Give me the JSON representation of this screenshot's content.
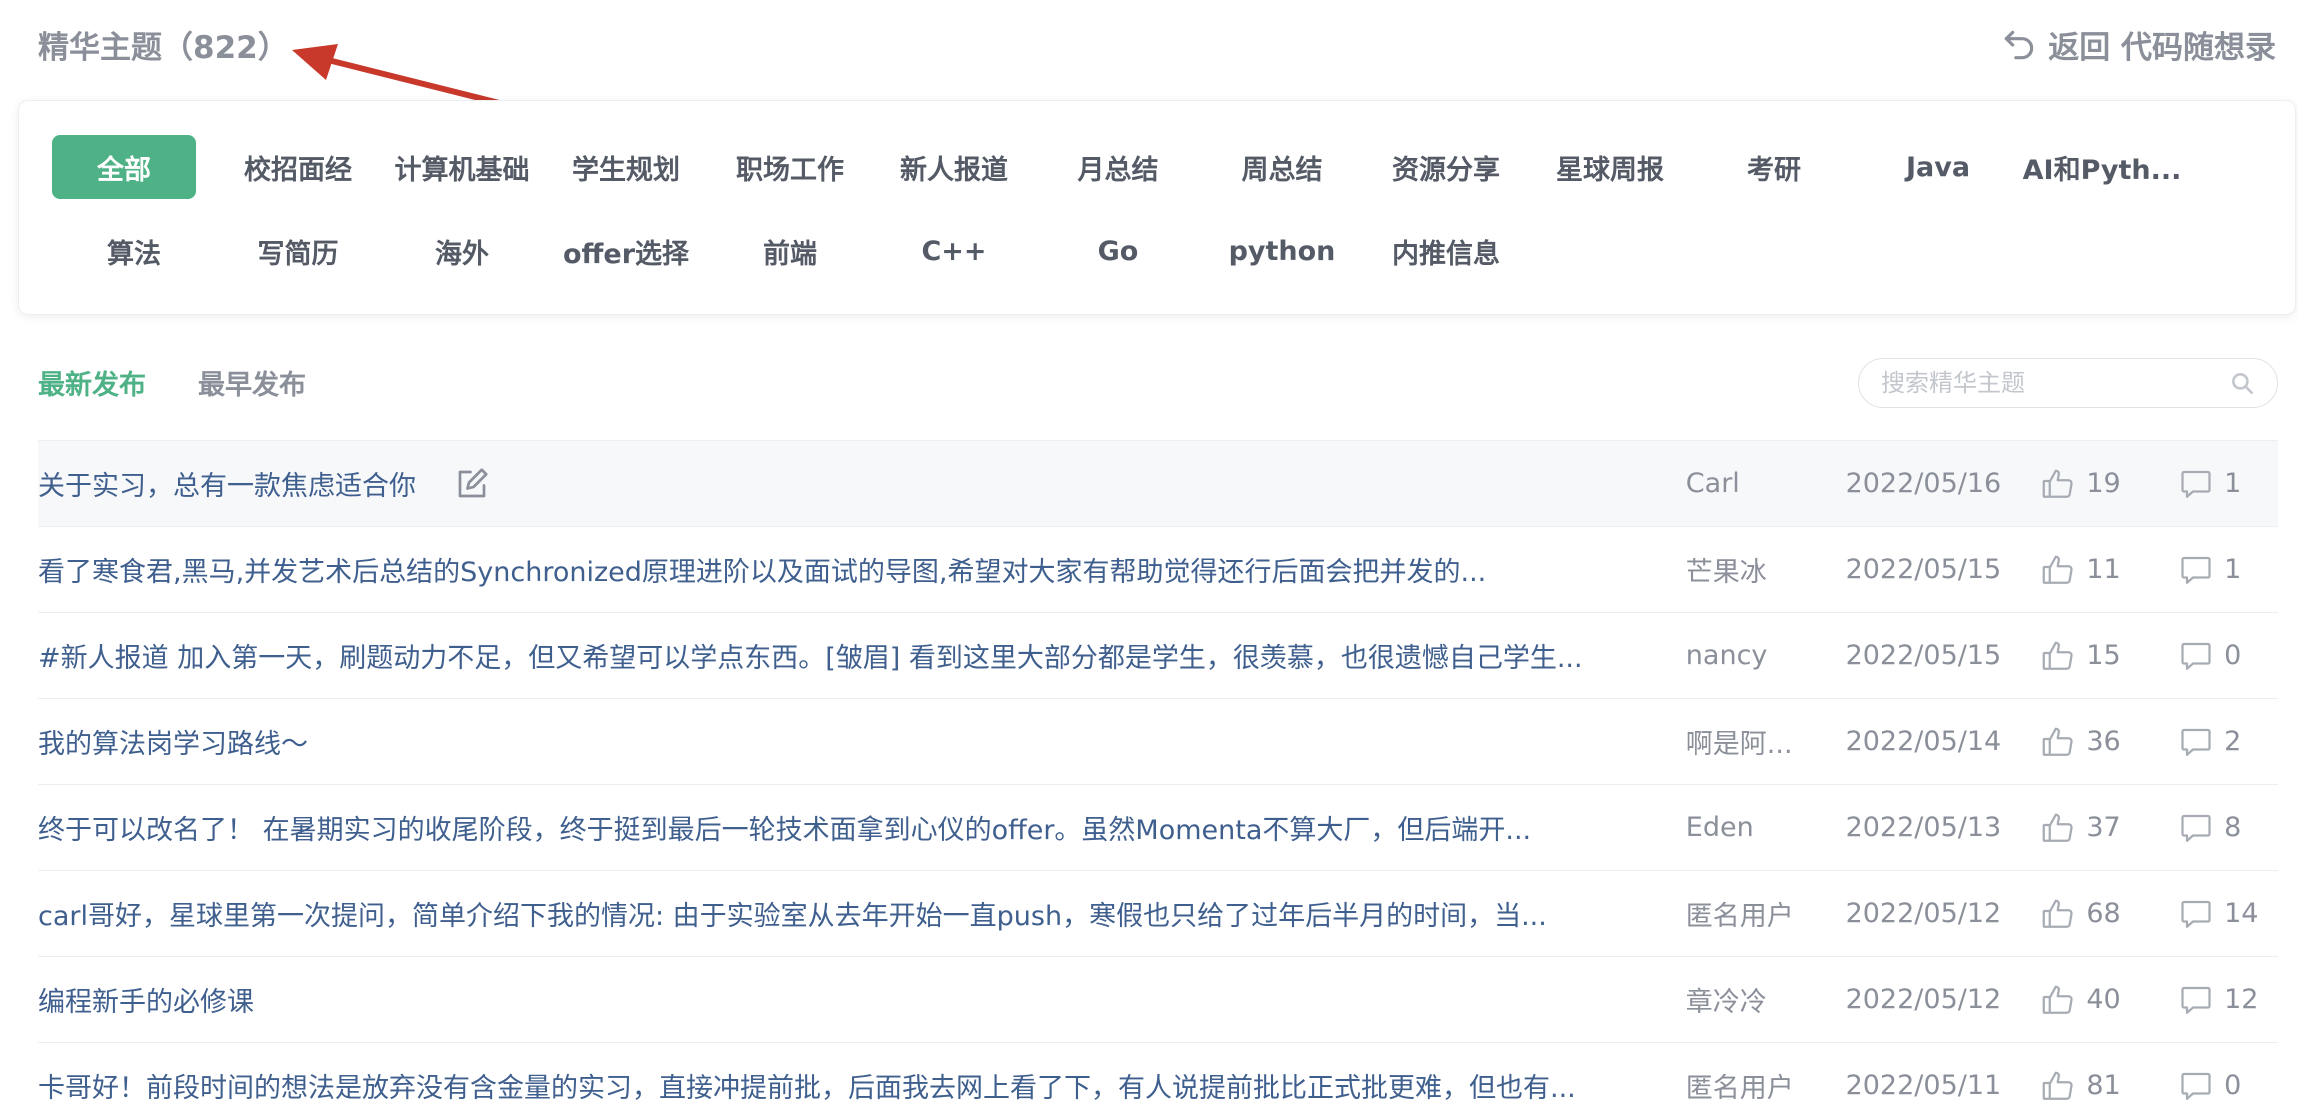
{
  "header": {
    "title": "精华主题（822）",
    "back_label": "返回 代码随想录"
  },
  "categories": [
    {
      "label": "全部",
      "active": true
    },
    {
      "label": "校招面经"
    },
    {
      "label": "计算机基础"
    },
    {
      "label": "学生规划"
    },
    {
      "label": "职场工作"
    },
    {
      "label": "新人报道"
    },
    {
      "label": "月总结"
    },
    {
      "label": "周总结"
    },
    {
      "label": "资源分享"
    },
    {
      "label": "星球周报"
    },
    {
      "label": "考研"
    },
    {
      "label": "Java"
    },
    {
      "label": "AI和Pyth..."
    },
    {
      "label": "算法"
    },
    {
      "label": "写简历"
    },
    {
      "label": "海外"
    },
    {
      "label": "offer选择"
    },
    {
      "label": "前端"
    },
    {
      "label": "C++"
    },
    {
      "label": "Go"
    },
    {
      "label": "python"
    },
    {
      "label": "内推信息"
    }
  ],
  "sort": {
    "newest": "最新发布",
    "oldest": "最早发布"
  },
  "search": {
    "placeholder": "搜索精华主题"
  },
  "topics": [
    {
      "title": "关于实习，总有一款焦虑适合你",
      "author": "Carl",
      "date": "2022/05/16",
      "likes": "19",
      "comments": "1",
      "editable": true
    },
    {
      "title": "看了寒食君,黑马,并发艺术后总结的Synchronized原理进阶以及面试的导图,希望对大家有帮助觉得还行后面会把并发的...",
      "author": "芒果冰",
      "date": "2022/05/15",
      "likes": "11",
      "comments": "1"
    },
    {
      "title": "#新人报道 加入第一天，刷题动力不足，但又希望可以学点东西。[皱眉] 看到这里大部分都是学生，很羡慕，也很遗憾自己学生...",
      "author": "nancy",
      "date": "2022/05/15",
      "likes": "15",
      "comments": "0"
    },
    {
      "title": "我的算法岗学习路线～",
      "author": "啊是阿...",
      "date": "2022/05/14",
      "likes": "36",
      "comments": "2"
    },
    {
      "title": "终于可以改名了！ 在暑期实习的收尾阶段，终于挺到最后一轮技术面拿到心仪的offer。虽然Momenta不算大厂，但后端开...",
      "author": "Eden",
      "date": "2022/05/13",
      "likes": "37",
      "comments": "8"
    },
    {
      "title": "carl哥好，星球里第一次提问，简单介绍下我的情况: 由于实验室从去年开始一直push，寒假也只给了过年后半月的时间，当...",
      "author": "匿名用户",
      "date": "2022/05/12",
      "likes": "68",
      "comments": "14"
    },
    {
      "title": "编程新手的必修课",
      "author": "章冷冷",
      "date": "2022/05/12",
      "likes": "40",
      "comments": "12"
    },
    {
      "title": "卡哥好！前段时间的想法是放弃没有含金量的实习，直接冲提前批，后面我去网上看了下，有人说提前批比正式批更难，但也有...",
      "author": "匿名用户",
      "date": "2022/05/11",
      "likes": "81",
      "comments": "0"
    }
  ],
  "colors": {
    "accent": "#4fb286",
    "link": "#3f5f8e",
    "muted": "#8a8f99",
    "annotation_arrow": "#c8392b"
  }
}
